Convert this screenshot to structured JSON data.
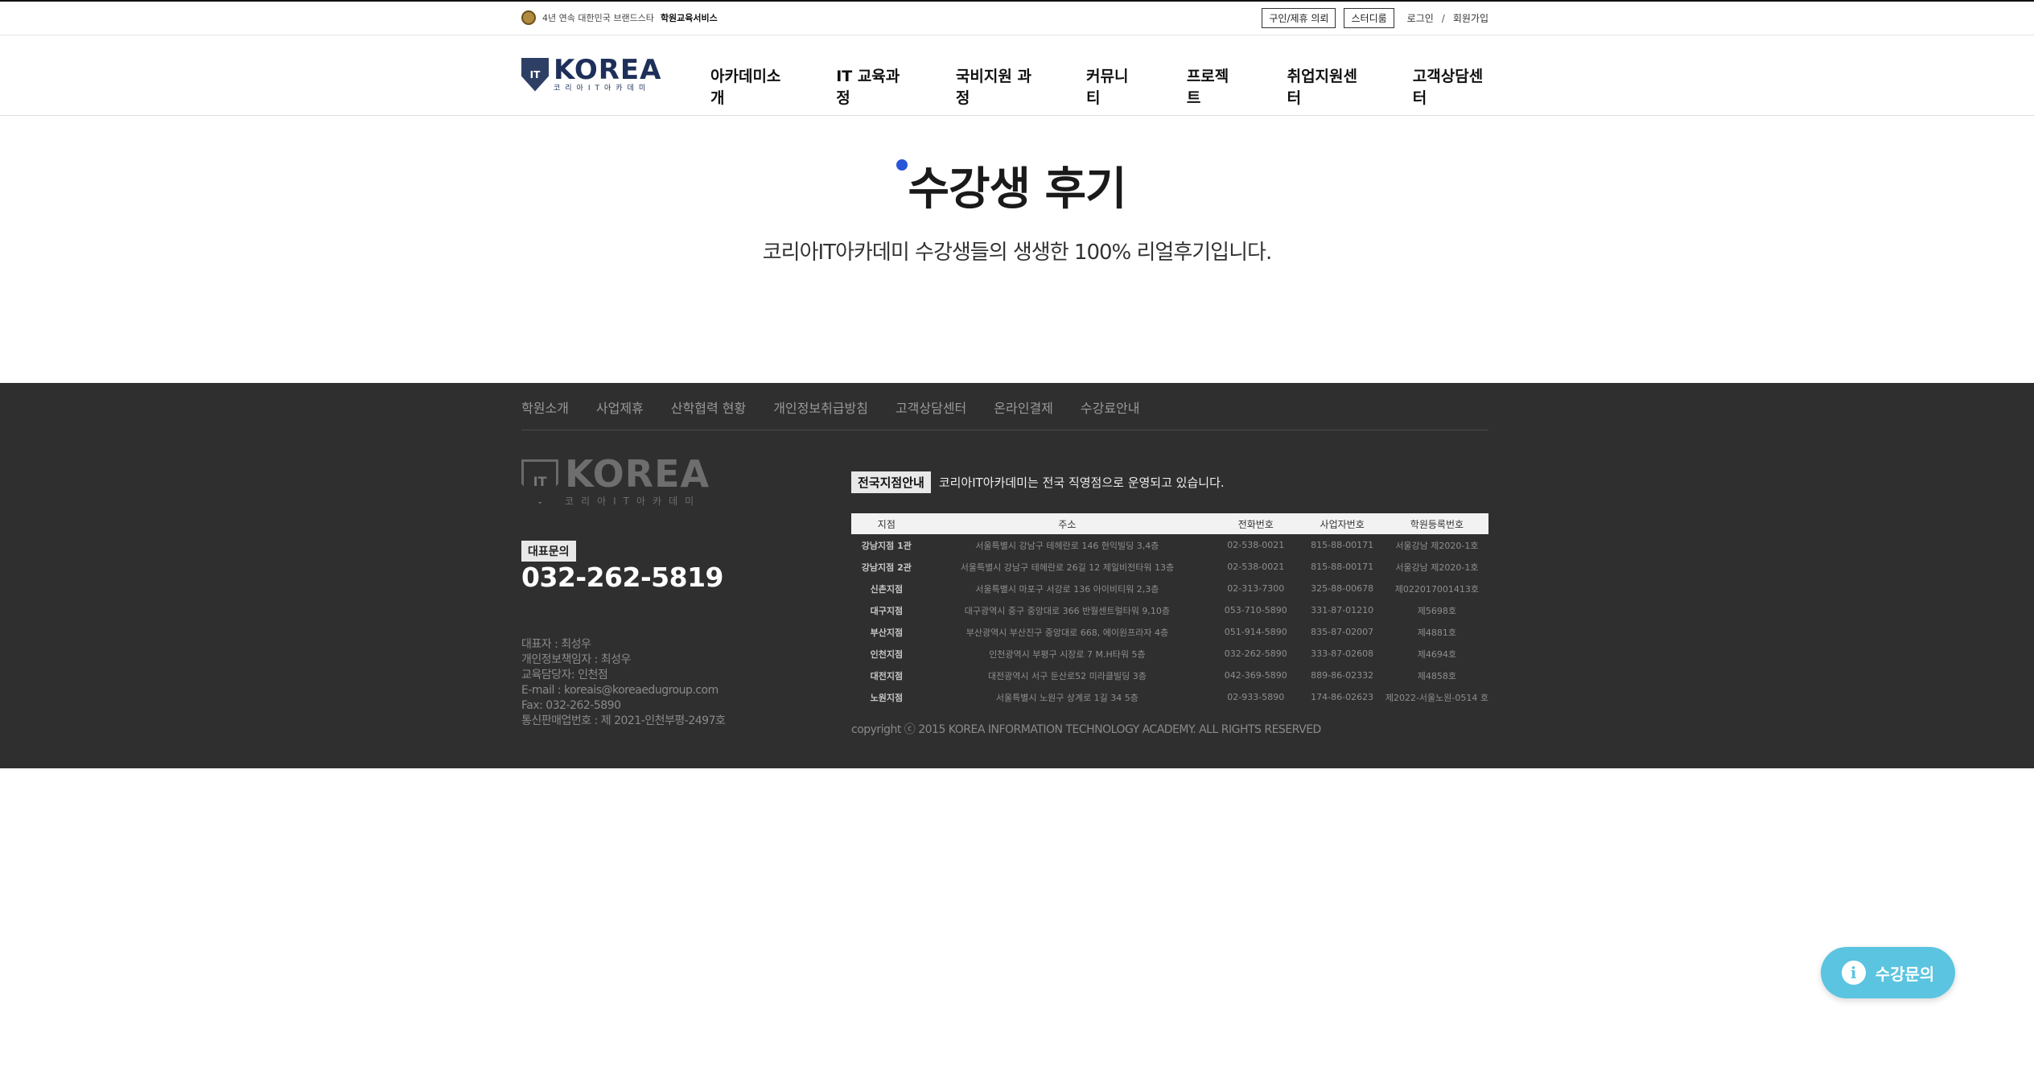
{
  "topbar": {
    "tagline_prefix": "4년 연속 대한민국 브랜드스타",
    "tagline_bold": "학원교육서비스",
    "buttons": [
      "구인/제휴 의뢰",
      "스터디룸"
    ],
    "login": "로그인",
    "divider": "/",
    "signup": "회원가입"
  },
  "header": {
    "logo_main": "KOREA",
    "logo_sub": "코리아IT아카데미",
    "logo_badge": "IT",
    "nav": [
      "아카데미소개",
      "IT 교육과정",
      "국비지원 과정",
      "커뮤니티",
      "프로젝트",
      "취업지원센터",
      "고객상담센터"
    ]
  },
  "main": {
    "title": "수강생 후기",
    "subtitle": "코리아IT아카데미 수강생들의 생생한 100% 리얼후기입니다."
  },
  "footer": {
    "nav": [
      "학원소개",
      "사업제휴",
      "산학협력 현황",
      "개인정보취급방침",
      "고객상담센터",
      "온라인결제",
      "수강료안내"
    ],
    "logo_main": "KOREA",
    "logo_sub": "코리아IT아카데미",
    "logo_badge": "IT",
    "rep_label": "대표문의",
    "rep_phone": "032-262-5819",
    "info": [
      "대표자 : 최성우",
      "개인정보책임자 : 최성우",
      "교육담당자: 인천점",
      "E-mail : koreais@koreaedugroup.com",
      "Fax: 032-262-5890",
      "통신판매업번호 : 제 2021-인천부평-2497호"
    ],
    "branch_tag": "전국지점안내",
    "branch_desc": "코리아IT아카데미는 전국 직영점으로 운영되고 있습니다.",
    "table_headers": [
      "지점",
      "주소",
      "전화번호",
      "사업자번호",
      "학원등록번호"
    ],
    "branches": [
      [
        "강남지점 1관",
        "서울특별시 강남구 테헤란로 146 현익빌딩 3,4층",
        "02-538-0021",
        "815-88-00171",
        "서울강남 제2020-1호"
      ],
      [
        "강남지점 2관",
        "서울특별시 강남구 테헤란로 26길 12 제일비전타워 13층",
        "02-538-0021",
        "815-88-00171",
        "서울강남 제2020-1호"
      ],
      [
        "신촌지점",
        "서울특별시 마포구 서강로 136 아이비티워 2,3층",
        "02-313-7300",
        "325-88-00678",
        "제022017001413호"
      ],
      [
        "대구지점",
        "대구광역시 중구 중앙대로 366 반월센트럴타워 9,10층",
        "053-710-5890",
        "331-87-01210",
        "제5698호"
      ],
      [
        "부산지점",
        "부산광역시 부산진구 중앙대로 668, 에이원프라자 4층",
        "051-914-5890",
        "835-87-02007",
        "제4881호"
      ],
      [
        "인천지점",
        "인천광역시 부평구 시장로 7 M.H타워 5층",
        "032-262-5890",
        "333-87-02608",
        "제4694호"
      ],
      [
        "대전지점",
        "대전광역시 서구 둔산로52 미라클빌딩 3층",
        "042-369-5890",
        "889-86-02332",
        "제4858호"
      ],
      [
        "노원지점",
        "서울특별시 노원구 상계로 1길 34 5층",
        "02-933-5890",
        "174-86-02623",
        "제2022-서울노원-0514 호"
      ]
    ],
    "copyright": "copyright ⓒ 2015 KOREA INFORMATION TECHNOLOGY ACADEMY. ALL RIGHTS RESERVED"
  },
  "float": {
    "icon": "info-icon",
    "label": "수강문의"
  }
}
